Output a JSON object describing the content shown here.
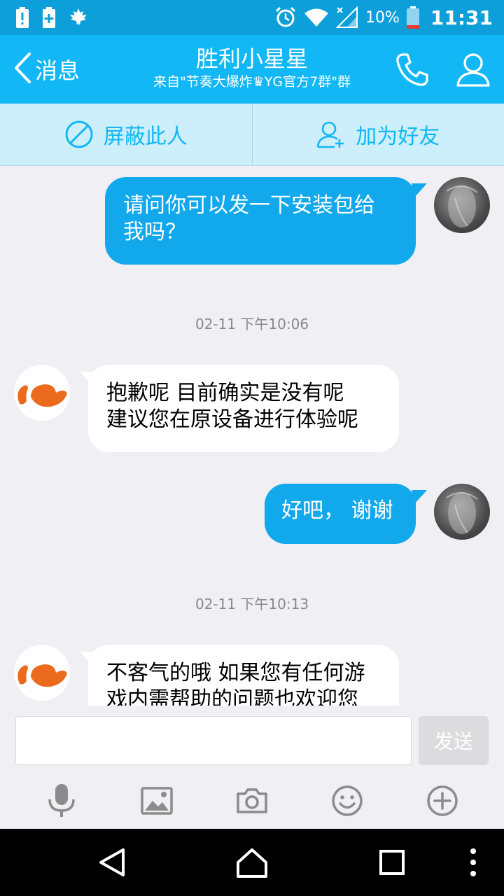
{
  "status_bar": {
    "battery_percent": "10%",
    "time": "11:31",
    "icons": [
      "battery-alert-icon",
      "battery-plus-icon",
      "maple-leaf-icon",
      "alarm-icon",
      "wifi-icon",
      "signal-icon",
      "battery-icon"
    ]
  },
  "header": {
    "back_label": "消息",
    "title": "胜利小星星",
    "subtitle": "来自\"节奏大爆炸♛YG官方7群\"群"
  },
  "actions": {
    "block_label": "屏蔽此人",
    "add_friend_label": "加为好友"
  },
  "messages": [
    {
      "direction": "out",
      "text_lines": [
        "请问你可以发一下安装包给",
        "我吗？"
      ]
    },
    {
      "type": "timestamp",
      "text": "02-11 下午10:06"
    },
    {
      "direction": "in",
      "text_lines": [
        "抱歉呢 目前确实是没有呢",
        "建议您在原设备进行体验呢"
      ]
    },
    {
      "direction": "out",
      "text_lines": [
        "好吧， 谢谢"
      ]
    },
    {
      "type": "timestamp",
      "text": "02-11 下午10:13"
    },
    {
      "direction": "in",
      "text_lines": [
        "不客气的哦 如果您有任何游",
        "戏内需帮助的问题也欢迎您"
      ]
    }
  ],
  "input": {
    "value": "",
    "placeholder": "",
    "send_label": "发送"
  },
  "toolbar": [
    "microphone-icon",
    "image-icon",
    "camera-icon",
    "emoji-icon",
    "plus-icon"
  ],
  "colors": {
    "header": "#12b7f5",
    "status_bar": "#0c9fda",
    "outgoing_bubble": "#12a8ec",
    "action_bar": "#cdeefb",
    "service_logo": "#ec6a1e"
  }
}
